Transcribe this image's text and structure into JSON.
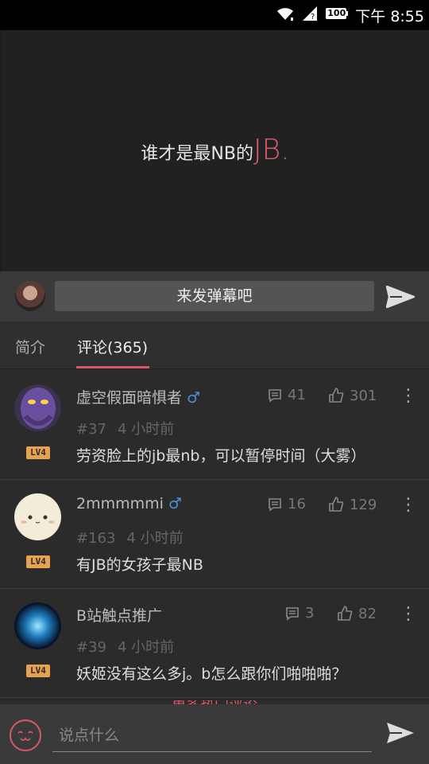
{
  "status_bar": {
    "battery": "100",
    "time": "下午 8:55"
  },
  "video": {
    "title_prefix": "谁才是最NB的",
    "title_accent": "JB."
  },
  "danmaku": {
    "placeholder": "来发弹幕吧"
  },
  "tabs": [
    {
      "label": "简介"
    },
    {
      "label": "评论(365)"
    }
  ],
  "comments": [
    {
      "user": "虚空假面暗惧者",
      "gender": "♂",
      "level": "LV4",
      "replies": "41",
      "likes": "301",
      "floor": "#37",
      "time": "4 小时前",
      "text": "劳资脸上的jb最nb，可以暂停时间（大雾）"
    },
    {
      "user": "2mmmmmi",
      "gender": "♂",
      "level": "LV4",
      "replies": "16",
      "likes": "129",
      "floor": "#163",
      "time": "4 小时前",
      "text": "有JB的女孩子最NB"
    },
    {
      "user": "B站触点推广",
      "gender": "",
      "level": "LV4",
      "replies": "3",
      "likes": "82",
      "floor": "#39",
      "time": "4 小时前",
      "text": "妖姬没有这么多j。b怎么跟你们啪啪啪？"
    }
  ],
  "more_hot": "更多热门评论",
  "composer": {
    "placeholder": "说点什么"
  },
  "colors": {
    "accent": "#d9566b",
    "gender_male": "#4a90d9",
    "level_badge": "#e8a14f"
  }
}
